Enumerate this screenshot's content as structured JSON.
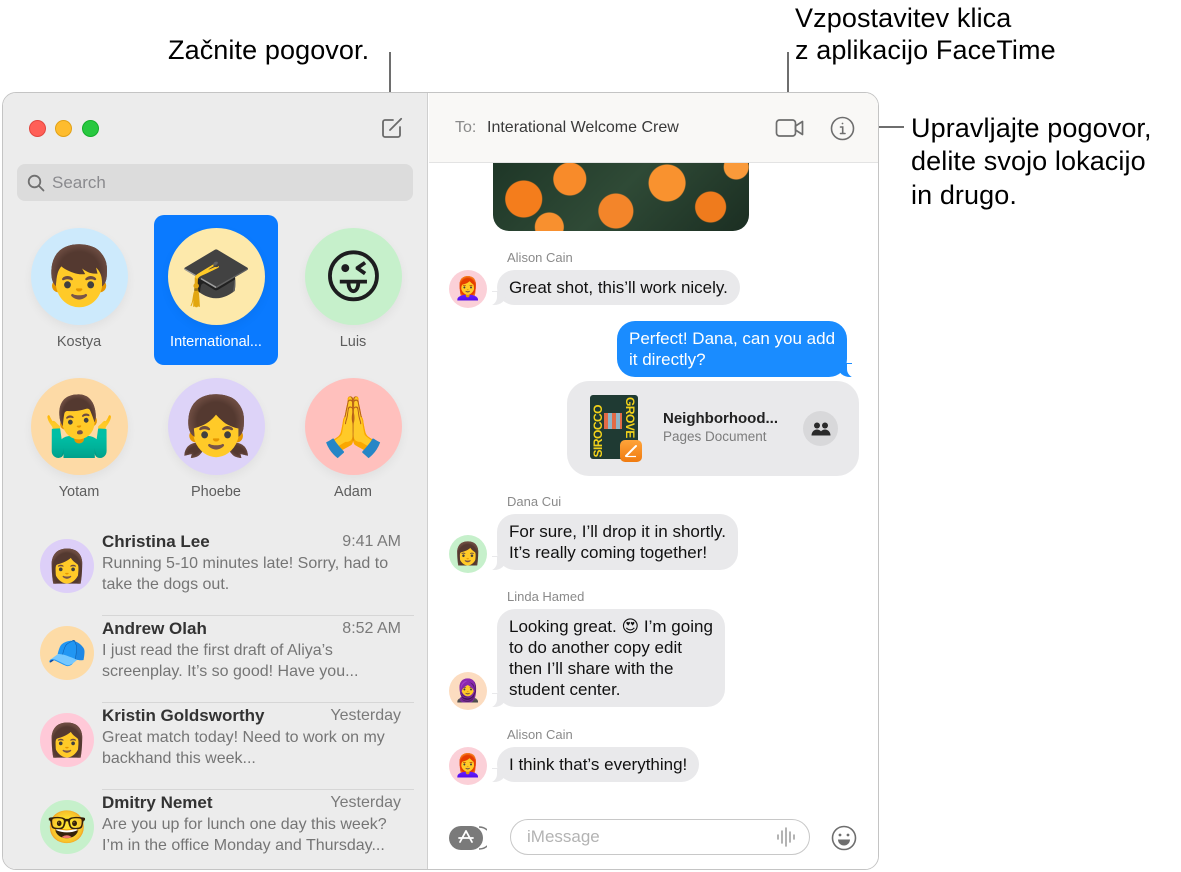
{
  "callouts": {
    "compose": "Začnite pogovor.",
    "facetime_line1": "Vzpostavitev klica",
    "facetime_line2": "z aplikacijo FaceTime",
    "info_line1": "Upravljajte pogovor,",
    "info_line2": "delite svojo lokacijo",
    "info_line3": "in drugo."
  },
  "sidebar": {
    "search_placeholder": "Search",
    "pinned": [
      {
        "label": "Kostya",
        "emoji": "👦",
        "bg": "#cdeafc",
        "selected": false
      },
      {
        "label": "International...",
        "emoji": "🎓",
        "bg": "#fde9ab",
        "selected": true
      },
      {
        "label": "Luis",
        "emoji": "😜",
        "bg": "#c6f0cb",
        "selected": false
      },
      {
        "label": "Yotam",
        "emoji": "🤷‍♂️",
        "bg": "#fddaa6",
        "selected": false
      },
      {
        "label": "Phoebe",
        "emoji": "👧",
        "bg": "#ddd3f8",
        "selected": false
      },
      {
        "label": "Adam",
        "emoji": "🙏",
        "bg": "#ffc0bd",
        "selected": false
      }
    ],
    "conversations": [
      {
        "name": "Christina Lee",
        "time": "9:41 AM",
        "preview": "Running 5-10 minutes late! Sorry, had to take the dogs out.",
        "emoji": "👩",
        "bg": "#ddcff8"
      },
      {
        "name": "Andrew Olah",
        "time": "8:52 AM",
        "preview": "I just read the first draft of Aliya’s screenplay. It’s so good! Have you...",
        "emoji": "🧢",
        "bg": "#fddba6"
      },
      {
        "name": "Kristin Goldsworthy",
        "time": "Yesterday",
        "preview": "Great match today! Need to work on my backhand this week...",
        "emoji": "👩",
        "bg": "#ffc9d8"
      },
      {
        "name": "Dmitry Nemet",
        "time": "Yesterday",
        "preview": "Are you up for lunch one day this week? I’m in the office Monday and Thursday...",
        "emoji": "🤓",
        "bg": "#c6f0cb"
      }
    ]
  },
  "chat": {
    "to_label": "To:",
    "to_value": "Interational Welcome Crew",
    "messages": [
      {
        "sender": "Alison Cain",
        "text": "Great shot, this’ll work nicely.",
        "direction": "in",
        "avatar_emoji": "👩‍🦰",
        "avatar_bg": "#fbd0d8"
      },
      {
        "sender": "",
        "text": "Perfect! Dana, can you add it directly?",
        "line1": "Perfect! Dana, can you add",
        "line2": "it directly?",
        "direction": "out"
      },
      {
        "sender": "Dana Cui",
        "line1": "For sure, I’ll drop it in shortly.",
        "line2": "It’s really coming together!",
        "direction": "in",
        "avatar_emoji": "👩",
        "avatar_bg": "#c6f0cb"
      },
      {
        "sender": "Linda Hamed",
        "line1": "Looking great. 😍 I’m going",
        "line2": "to do another copy edit",
        "line3": "then I’ll share with the",
        "line4": "student center.",
        "direction": "in",
        "avatar_emoji": "🧕",
        "avatar_bg": "#fcdcc0"
      },
      {
        "sender": "Alison Cain",
        "text": "I think that’s everything!",
        "direction": "in",
        "avatar_emoji": "👩‍🦰",
        "avatar_bg": "#fbd0d8"
      }
    ],
    "attachment": {
      "title": "Neighborhood...",
      "subtitle": "Pages Document",
      "thumb_text_left": "SIROCCO",
      "thumb_text_right": "GROVE"
    },
    "composer_placeholder": "iMessage"
  },
  "colors": {
    "accent": "#0a7aff",
    "outgoing_bubble": "#1a8cff",
    "incoming_bubble": "#e9e9eb",
    "sidebar_bg": "#ececec"
  }
}
